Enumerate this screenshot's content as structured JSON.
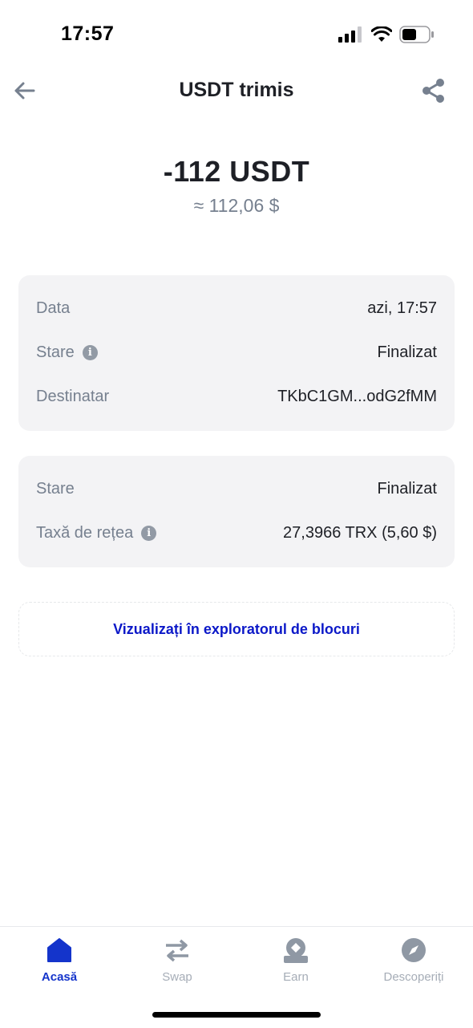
{
  "status_bar": {
    "time": "17:57"
  },
  "header": {
    "title": "USDT trimis",
    "back_icon": "arrow-left-icon",
    "share_icon": "share-icon"
  },
  "amount": {
    "value": "-112 USDT",
    "fiat": "≈ 112,06 $"
  },
  "details_card": {
    "rows": [
      {
        "label": "Data",
        "value": "azi, 17:57"
      },
      {
        "label": "Stare",
        "value": "Finalizat"
      },
      {
        "label": "Destinatar",
        "value": "TKbC1GM...odG2fMM"
      }
    ]
  },
  "network_card": {
    "rows": [
      {
        "label": "Stare",
        "value": "Finalizat"
      },
      {
        "label": "Taxă de rețea",
        "value": "27,3966 TRX (5,60 $)"
      }
    ]
  },
  "explorer_button": {
    "label": "Vizualizați în exploratorul de blocuri"
  },
  "bottom_nav": {
    "items": [
      {
        "label": "Acasă",
        "icon": "home-icon",
        "active": true
      },
      {
        "label": "Swap",
        "icon": "swap-arrows-icon",
        "active": false
      },
      {
        "label": "Earn",
        "icon": "earn-icon",
        "active": false
      },
      {
        "label": "Descoperiți",
        "icon": "compass-icon",
        "active": false
      }
    ]
  },
  "colors": {
    "accent": "#1434cb",
    "link": "#0b18c8",
    "muted_text": "#76808f",
    "card_bg": "#f3f3f5"
  }
}
